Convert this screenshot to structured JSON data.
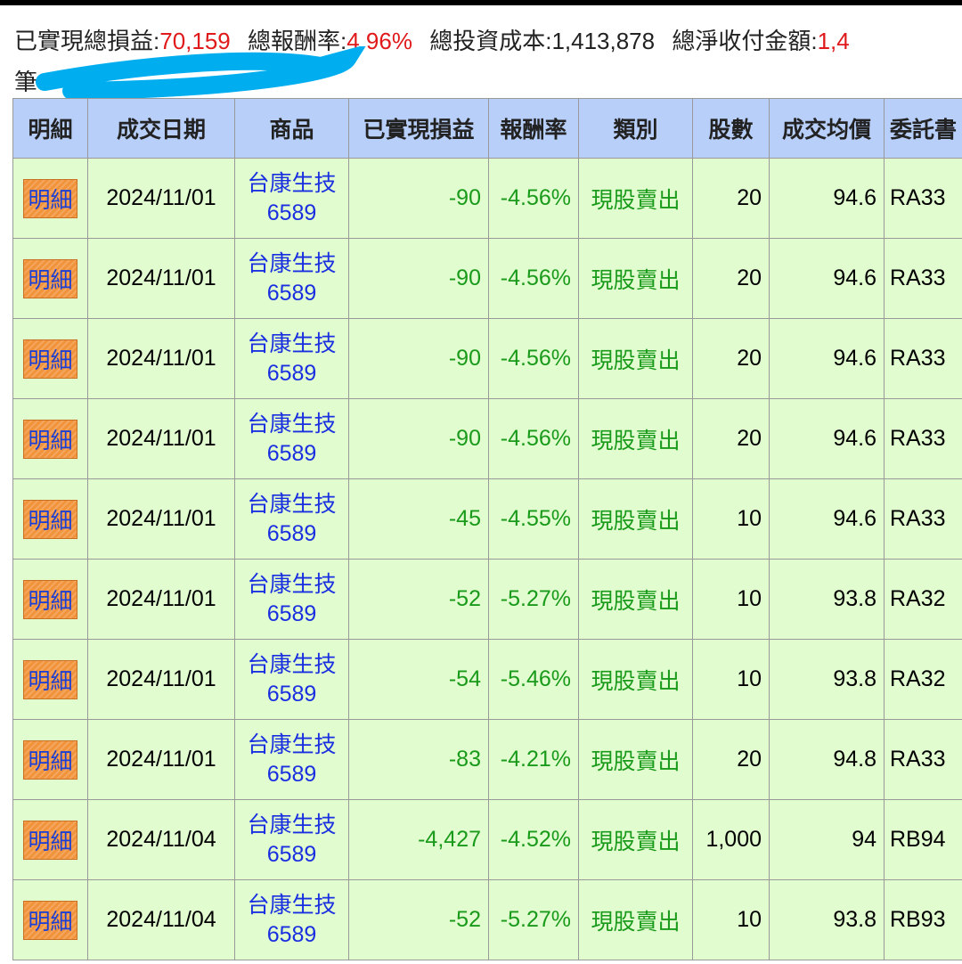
{
  "summary": {
    "realized_label": "已實現總損益:",
    "realized_value": "70,159",
    "return_label": "總報酬率:",
    "return_value": "4.96%",
    "cost_label": "總投資成本:",
    "cost_value": "1,413,878",
    "net_label": "總淨收付金額:",
    "net_value": "1,4",
    "count_label": "筆"
  },
  "colors": {
    "header_bg": "#b8cffa",
    "row_bg": "#e1fdd0",
    "loss": "#1a9a1a",
    "profit": "#e0191b"
  },
  "table": {
    "headers": [
      "明細",
      "成交日期",
      "商品",
      "已實現損益",
      "報酬率",
      "類別",
      "股數",
      "成交均價",
      "委託書"
    ],
    "rows": [
      {
        "btn": "明細",
        "date": "2024/11/01",
        "name": "台康生技",
        "code": "6589",
        "pl": "-90",
        "rate": "-4.56%",
        "type": "現股賣出",
        "qty": "20",
        "price": "94.6",
        "order": "RA33"
      },
      {
        "btn": "明細",
        "date": "2024/11/01",
        "name": "台康生技",
        "code": "6589",
        "pl": "-90",
        "rate": "-4.56%",
        "type": "現股賣出",
        "qty": "20",
        "price": "94.6",
        "order": "RA33"
      },
      {
        "btn": "明細",
        "date": "2024/11/01",
        "name": "台康生技",
        "code": "6589",
        "pl": "-90",
        "rate": "-4.56%",
        "type": "現股賣出",
        "qty": "20",
        "price": "94.6",
        "order": "RA33"
      },
      {
        "btn": "明細",
        "date": "2024/11/01",
        "name": "台康生技",
        "code": "6589",
        "pl": "-90",
        "rate": "-4.56%",
        "type": "現股賣出",
        "qty": "20",
        "price": "94.6",
        "order": "RA33"
      },
      {
        "btn": "明細",
        "date": "2024/11/01",
        "name": "台康生技",
        "code": "6589",
        "pl": "-45",
        "rate": "-4.55%",
        "type": "現股賣出",
        "qty": "10",
        "price": "94.6",
        "order": "RA33"
      },
      {
        "btn": "明細",
        "date": "2024/11/01",
        "name": "台康生技",
        "code": "6589",
        "pl": "-52",
        "rate": "-5.27%",
        "type": "現股賣出",
        "qty": "10",
        "price": "93.8",
        "order": "RA32"
      },
      {
        "btn": "明細",
        "date": "2024/11/01",
        "name": "台康生技",
        "code": "6589",
        "pl": "-54",
        "rate": "-5.46%",
        "type": "現股賣出",
        "qty": "10",
        "price": "93.8",
        "order": "RA32"
      },
      {
        "btn": "明細",
        "date": "2024/11/01",
        "name": "台康生技",
        "code": "6589",
        "pl": "-83",
        "rate": "-4.21%",
        "type": "現股賣出",
        "qty": "20",
        "price": "94.8",
        "order": "RA33"
      },
      {
        "btn": "明細",
        "date": "2024/11/04",
        "name": "台康生技",
        "code": "6589",
        "pl": "-4,427",
        "rate": "-4.52%",
        "type": "現股賣出",
        "qty": "1,000",
        "price": "94",
        "order": "RB94"
      },
      {
        "btn": "明細",
        "date": "2024/11/04",
        "name": "台康生技",
        "code": "6589",
        "pl": "-52",
        "rate": "-5.27%",
        "type": "現股賣出",
        "qty": "10",
        "price": "93.8",
        "order": "RB93"
      }
    ]
  }
}
